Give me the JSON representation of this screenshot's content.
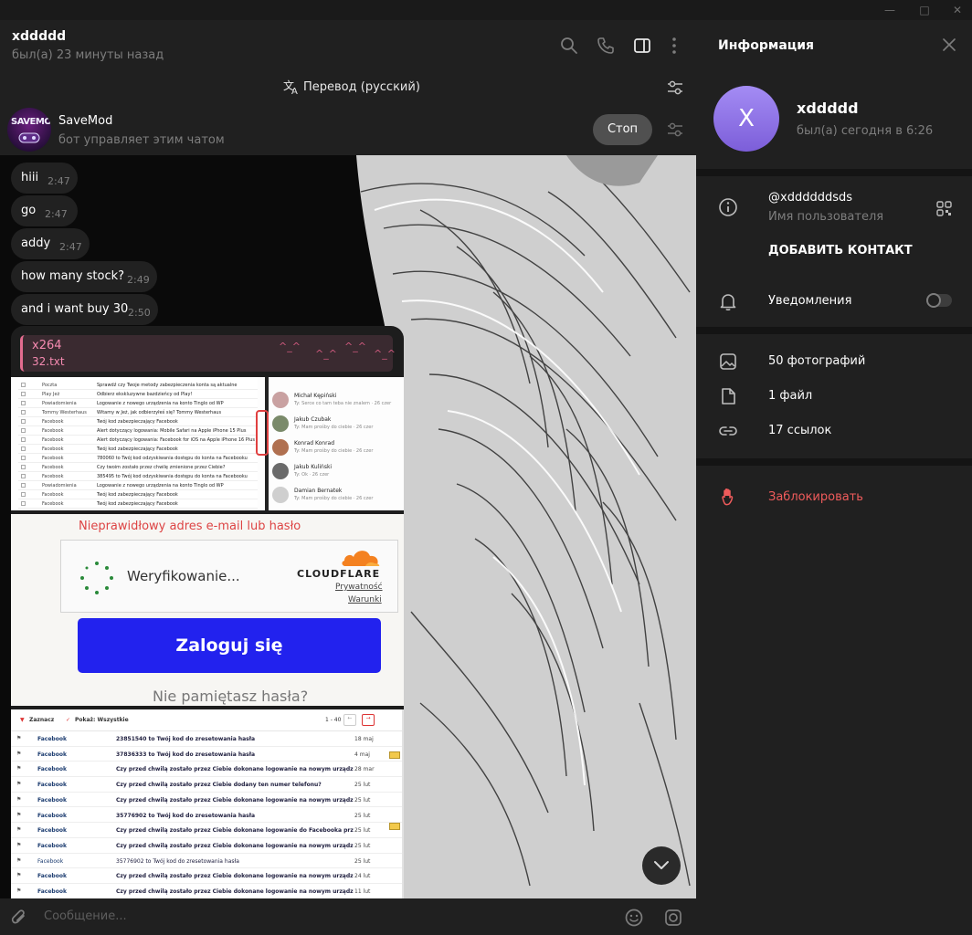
{
  "chat": {
    "name": "xddddd",
    "status": "был(а) 23 минуты назад"
  },
  "translate": {
    "label": "Перевод (русский)"
  },
  "bot": {
    "name": "SaveMod",
    "description": "бот управляет этим чатом",
    "stop_label": "Стоп",
    "avatar_text": "SAVEMOD"
  },
  "messages": [
    {
      "text": "hiii",
      "time": "2:47"
    },
    {
      "text": "go",
      "time": "2:47"
    },
    {
      "text": "addy",
      "time": "2:47"
    },
    {
      "text": "how many stock?",
      "time": "2:49"
    },
    {
      "text": "and i want buy 30",
      "time": "2:50"
    }
  ],
  "media_message": {
    "reply_title": "x264",
    "reply_file": "32.txt",
    "deco": "^_^"
  },
  "screenshot_mail": {
    "rows": [
      {
        "from": "Poczta",
        "subject": "Sprawdź czy Twoje metody zabezpieczenia konta są aktualne"
      },
      {
        "from": "Play Jeż",
        "subject": "Odbierz ekskluzywne bazdzieńcy od Play!"
      },
      {
        "from": "Powiadomienia",
        "subject": "Logowanie z nowego urządzenia na konto Tinglo od WP"
      },
      {
        "from": "Tommy Westerhaus",
        "subject": "Witamy w Jeż, jak odbierzyłeś się? Tommy Westerhaus"
      },
      {
        "from": "Facebook",
        "subject": "Twój kod zabezpieczający Facebook"
      },
      {
        "from": "Facebook",
        "subject": "Alert dotyczący logowania: Mobile Safari na Apple iPhone 15 Plus"
      },
      {
        "from": "Facebook",
        "subject": "Alert dotyczący logowania: Facebook for iOS na Apple iPhone 16 Plus"
      },
      {
        "from": "Facebook",
        "subject": "Twój kod zabezpieczający Facebook"
      },
      {
        "from": "Facebook",
        "subject": "780060 to Twój kod odzyskiwania dostępu do konta na Facebooku"
      },
      {
        "from": "Facebook",
        "subject": "Czy twoim zostało przez chwilę zmienione przez Ciebie?"
      },
      {
        "from": "Facebook",
        "subject": "385495 to Twój kod odzyskiwania dostępu do konta na Facebooku"
      },
      {
        "from": "Powiadomienia",
        "subject": "Logowanie z nowego urządzenia na konto Tinglo od WP"
      },
      {
        "from": "Facebook",
        "subject": "Twój kod zabezpieczający Facebook"
      },
      {
        "from": "Facebook",
        "subject": "Twój kod zabezpieczający Facebook"
      }
    ],
    "contacts": [
      {
        "name": "Michał Kępiński",
        "sub": "Ty: Serce co tam teba nie znalem · 26 czer"
      },
      {
        "name": "Jakub Czubak",
        "sub": "Ty: Mam prośby do ciebie · 26 czer"
      },
      {
        "name": "Konrad Konrad",
        "sub": "Ty: Mam prośby do ciebie · 26 czer"
      },
      {
        "name": "Jakub Kuliński",
        "sub": "Ty: Ok · 26 czer"
      },
      {
        "name": "Damian Bernatek",
        "sub": "Ty: Mam prośby do ciebie · 26 czer"
      }
    ]
  },
  "screenshot_cloudflare": {
    "error": "Nieprawidłowy adres e-mail lub hasło",
    "verifying": "Weryfikowanie...",
    "brand": "CLOUDFLARE",
    "privacy": "Prywatność",
    "terms": "Warunki",
    "login": "Zaloguj się",
    "forgot": "Nie pamiętasz hasła?"
  },
  "screenshot_inbox": {
    "select_label": "Zaznacz",
    "show_label": "Pokaż: Wszystkie",
    "range": "1 - 40",
    "rows": [
      {
        "from": "Facebook",
        "subject": "23851540 to Twój kod do zresetowania hasła",
        "preview": "Kamilu, jeszcze jeden krok, aby zmienić h...",
        "date": "18 maj"
      },
      {
        "from": "Facebook",
        "subject": "37836333 to Twój kod do zresetowania hasła",
        "preview": "Kamilu, jeszcze jeden krok, aby zmienić h...",
        "date": "4 maj"
      },
      {
        "from": "Facebook",
        "subject": "Czy przed chwilą zostało przez Ciebie dokonane logowanie na nowym urządzeniu w po...",
        "preview": "",
        "date": "28 mar"
      },
      {
        "from": "Facebook",
        "subject": "Czy przed chwilą zostało przez Ciebie dodany ten numer telefonu?",
        "preview": "Kamilu, powiadom na...",
        "date": "25 lut"
      },
      {
        "from": "Facebook",
        "subject": "Czy przed chwilą zostało przez Ciebie dokonane logowanie na nowym urządzeniu w po...",
        "preview": "",
        "date": "25 lut"
      },
      {
        "from": "Facebook",
        "subject": "35776902 to Twój kod do zresetowania hasła",
        "preview": "Możesz również dotknąć przycisku, aby po...",
        "date": "25 lut"
      },
      {
        "from": "Facebook",
        "subject": "Czy przed chwilą zostało przez Ciebie dokonane logowanie do Facebooka przy użyciu ko...",
        "preview": "",
        "date": "25 lut"
      },
      {
        "from": "Facebook",
        "subject": "Czy przed chwilą zostało przez Ciebie dokonane logowanie na nowym urządzeniu w po...",
        "preview": "",
        "date": "25 lut"
      },
      {
        "from": "Facebook",
        "subject": "35776902 to Twój kod do zresetowania hasła",
        "preview": "Możesz również dotknąć przycisku, aby po...",
        "date": "25 lut"
      },
      {
        "from": "Facebook",
        "subject": "Czy przed chwilą zostało przez Ciebie dokonane logowanie na nowym urządzeniu w po...",
        "preview": "",
        "date": "24 lut"
      },
      {
        "from": "Facebook",
        "subject": "Czy przed chwilą zostało przez Ciebie dokonane logowanie na nowym urządzeniu w pobli...",
        "preview": "",
        "date": "11 lut"
      }
    ]
  },
  "composer": {
    "placeholder": "Сообщение..."
  },
  "panel": {
    "title": "Информация",
    "avatar_letter": "X",
    "name": "xddddd",
    "status": "был(а) сегодня в 6:26",
    "username": "@xddddddsds",
    "username_label": "Имя пользователя",
    "add_contact": "ДОБАВИТЬ КОНТАКТ",
    "notifications": "Уведомления",
    "notifications_on": false,
    "photos": "50 фотографий",
    "files": "1 файл",
    "links": "17 ссылок",
    "block": "Заблокировать"
  },
  "colors": {
    "accent_avatar": "#8e74e8",
    "block_red": "#ef5b5b",
    "bubble": "#212121",
    "panel": "#202020"
  }
}
